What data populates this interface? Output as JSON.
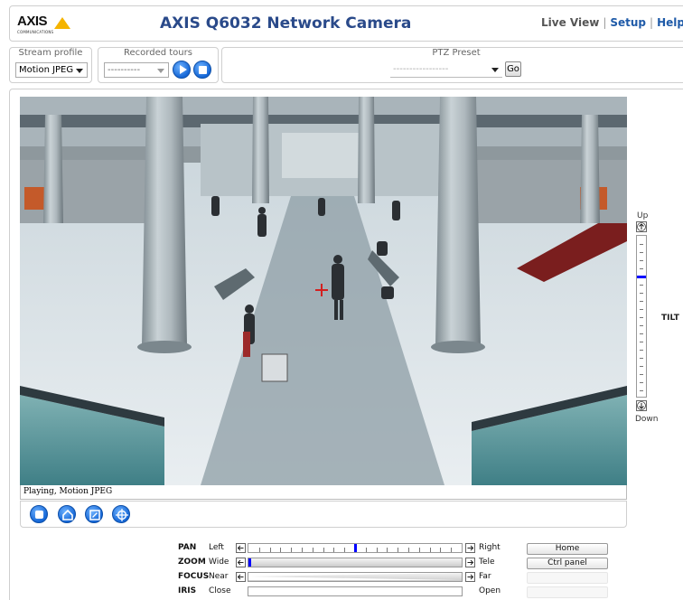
{
  "header": {
    "logo_text": "AXIS",
    "logo_sub": "COMMUNICATIONS",
    "title": "AXIS Q6032 Network Camera",
    "links": {
      "live_view": "Live View",
      "setup": "Setup",
      "help": "Help",
      "separator": "|"
    }
  },
  "stream_profile": {
    "label": "Stream profile",
    "value": "Motion JPEG"
  },
  "recorded_tours": {
    "label": "Recorded tours",
    "value": "----------"
  },
  "ptz_preset": {
    "label": "PTZ Preset",
    "value": "-----------------",
    "go_label": "Go"
  },
  "video": {
    "status_text": "Playing, Motion JPEG"
  },
  "tilt": {
    "label": "TILT",
    "up_label": "Up",
    "down_label": "Down",
    "position": 0.25
  },
  "controls": [
    {
      "name": "PAN",
      "left": "Left",
      "right": "Right",
      "position": 0.5,
      "style": "ticks"
    },
    {
      "name": "ZOOM",
      "left": "Wide",
      "right": "Tele",
      "position": 0.0,
      "style": "grad"
    },
    {
      "name": "FOCUS",
      "left": "Near",
      "right": "Far",
      "position": null,
      "style": "grad-taper"
    },
    {
      "name": "IRIS",
      "left": "Close",
      "right": "Open",
      "position": null,
      "style": "plain"
    }
  ],
  "buttons": {
    "home": "Home",
    "ctrl_panel": "Ctrl panel"
  },
  "colors": {
    "accent": "#1466d6",
    "title": "#2a4a8a",
    "marker": "#0000ff",
    "logo_yellow": "#f5b400"
  },
  "toolbar_icons": [
    "stop-icon",
    "snapshot-icon",
    "fullscreen-icon",
    "target-icon"
  ]
}
